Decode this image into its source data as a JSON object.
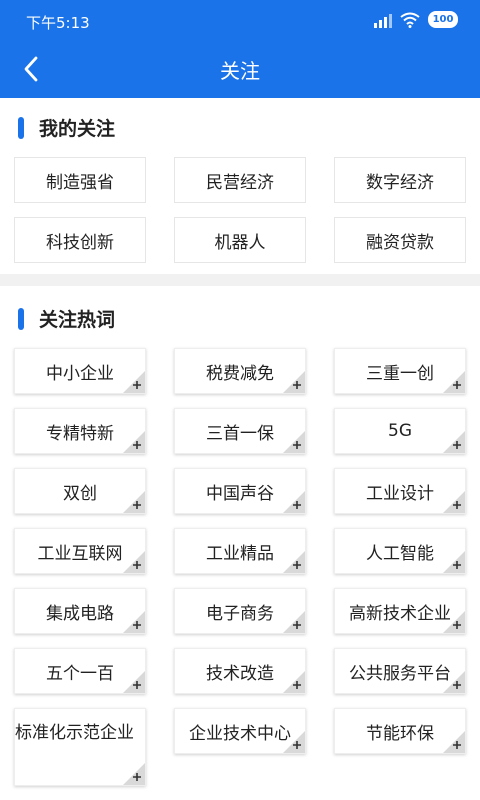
{
  "status": {
    "time": "下午5:13",
    "battery": "100"
  },
  "header": {
    "title": "关注"
  },
  "my_follow": {
    "heading": "我的关注",
    "tags": [
      "制造强省",
      "民营经济",
      "数字经济",
      "科技创新",
      "机器人",
      "融资贷款"
    ]
  },
  "hot_words": {
    "heading": "关注热词",
    "tags": [
      "中小企业",
      "税费减免",
      "三重一创",
      "专精特新",
      "三首一保",
      "5G",
      "双创",
      "中国声谷",
      "工业设计",
      "工业互联网",
      "工业精品",
      "人工智能",
      "集成电路",
      "电子商务",
      "高新技术企业",
      "五个一百",
      "技术改造",
      "公共服务平台",
      "标准化示范企业",
      "企业技术中心",
      "节能环保"
    ]
  },
  "colors": {
    "accent": "#1a73e8",
    "divider": "#f1f1f1"
  }
}
